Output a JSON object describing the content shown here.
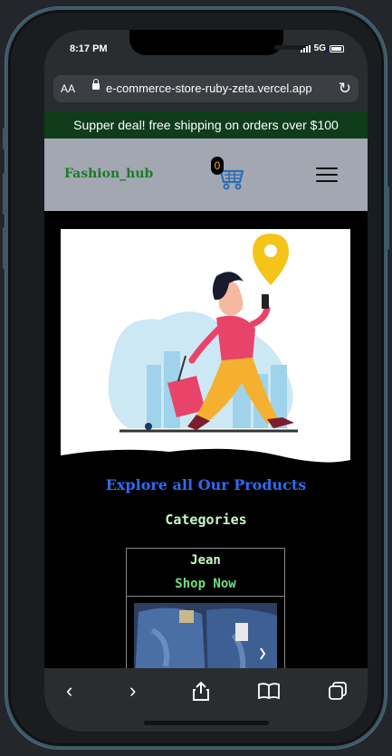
{
  "status_bar": {
    "time": "8:17 PM",
    "network": "5G"
  },
  "browser": {
    "aa_label": "AA",
    "url": "e-commerce-store-ruby-zeta.vercel.app",
    "reload_icon": "reload-icon"
  },
  "promo": {
    "text": "Supper deal! free shipping on orders over $100"
  },
  "navbar": {
    "brand": "Fashion_hub",
    "cart_count": "0",
    "cart_icon": "cart-icon",
    "menu_icon": "hamburger-icon"
  },
  "hero": {
    "image": "traveler-with-suitcase-illustration"
  },
  "explore": {
    "label": "Explore all Our Products"
  },
  "categories": {
    "heading": "Categories",
    "items": [
      {
        "name": "Jean",
        "cta": "Shop Now",
        "image": "jeans-photo"
      }
    ]
  },
  "toolbar": {
    "items": [
      "back-icon",
      "forward-icon",
      "share-icon",
      "bookmarks-icon",
      "tabs-icon"
    ]
  },
  "colors": {
    "promo_bg": "#0f3d1c",
    "navbar_bg": "#a2a7b1",
    "brand": "#1a7a2a",
    "explore": "#2d6bf0",
    "categories_text": "#c8f7c5"
  }
}
